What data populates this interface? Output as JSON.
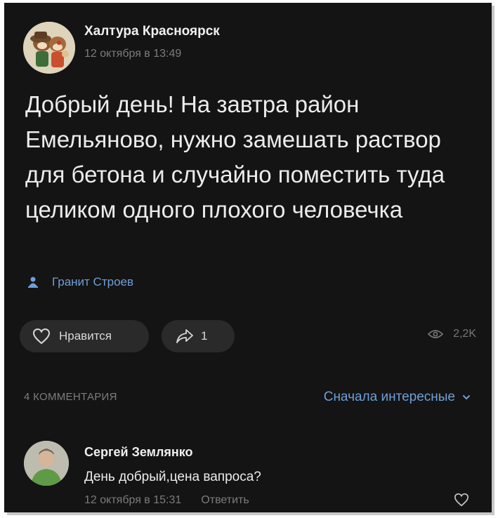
{
  "post": {
    "author": "Халтура Красноярск",
    "time": "12 октября в 13:49",
    "avatar_icon": "chip-and-dale-avatar",
    "text": "Добрый день! На завтра район Емельяново, нужно замешать раствор для бетона и случайно поместить туда целиком одного плохого человечка",
    "signer_icon": "person-icon",
    "signer": "Гранит Строев"
  },
  "actions": {
    "like_label": "Нравится",
    "like_icon": "heart-icon",
    "share_count": "1",
    "share_icon": "share-arrow-icon",
    "views_icon": "eye-icon",
    "views": "2,2K"
  },
  "comments_header": {
    "count_label": "4 КОММЕНТАРИЯ",
    "sort_label": "Сначала интересные",
    "sort_icon": "chevron-down-icon"
  },
  "comment": {
    "author": "Сергей Землянко",
    "text": "День добрый,цена вапроса?",
    "time": "12 октября в 15:31",
    "reply_label": "Ответить",
    "like_icon": "heart-icon"
  },
  "colors": {
    "background": "#141414",
    "accent": "#6f9fd8",
    "text": "#ececec",
    "muted": "#7c7c7c",
    "pill": "#2a2a2a"
  }
}
